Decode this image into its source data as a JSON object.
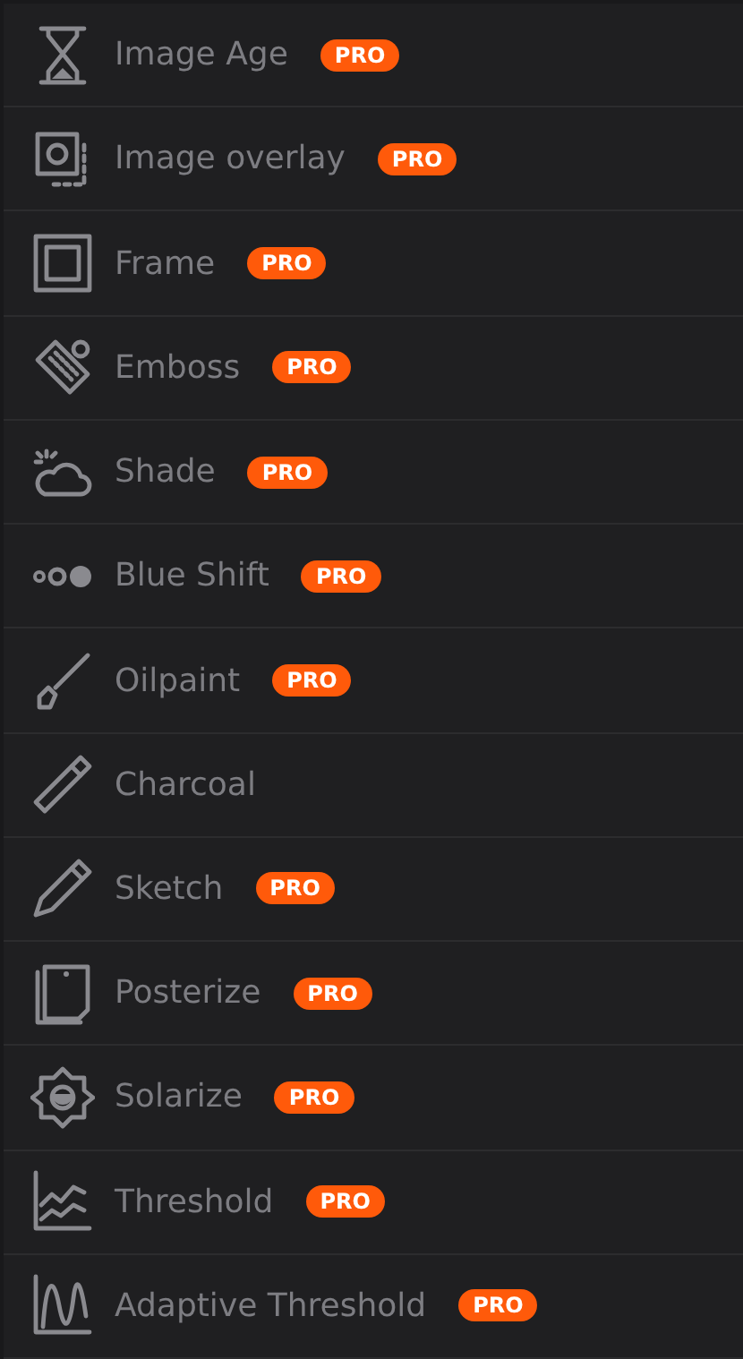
{
  "effects": [
    {
      "label": "Image Age",
      "pro": true,
      "badge": "PRO"
    },
    {
      "label": "Image overlay",
      "pro": true,
      "badge": "PRO"
    },
    {
      "label": "Frame",
      "pro": true,
      "badge": "PRO"
    },
    {
      "label": "Emboss",
      "pro": true,
      "badge": "PRO"
    },
    {
      "label": "Shade",
      "pro": true,
      "badge": "PRO"
    },
    {
      "label": "Blue Shift",
      "pro": true,
      "badge": "PRO"
    },
    {
      "label": "Oilpaint",
      "pro": true,
      "badge": "PRO"
    },
    {
      "label": "Charcoal",
      "pro": false
    },
    {
      "label": "Sketch",
      "pro": true,
      "badge": "PRO"
    },
    {
      "label": "Posterize",
      "pro": true,
      "badge": "PRO"
    },
    {
      "label": "Solarize",
      "pro": true,
      "badge": "PRO"
    },
    {
      "label": "Threshold",
      "pro": true,
      "badge": "PRO"
    },
    {
      "label": "Adaptive Threshold",
      "pro": true,
      "badge": "PRO"
    }
  ]
}
